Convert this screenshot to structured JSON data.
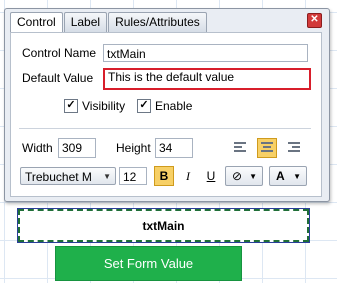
{
  "tabs": [
    "Control",
    "Label",
    "Rules/Attributes"
  ],
  "close_icon": "close-icon",
  "fields": {
    "control_name_label": "Control Name",
    "control_name_value": "txtMain",
    "default_value_label": "Default Value",
    "default_value_value": "This is the default value"
  },
  "checkboxes": {
    "visibility_label": "Visibility",
    "visibility_checked": true,
    "enable_label": "Enable",
    "enable_checked": true,
    "check_glyph": "✓"
  },
  "size": {
    "width_label": "Width",
    "width_value": "309",
    "height_label": "Height",
    "height_value": "34"
  },
  "alignment": {
    "selected": "center"
  },
  "font": {
    "family": "Trebuchet M",
    "size": "12",
    "bold_label": "B",
    "italic_label": "I",
    "underline_label": "U",
    "fill_icon": "fill-color-icon",
    "font_color_label": "A",
    "bold_active": true
  },
  "canvas": {
    "textbox_label": "txtMain",
    "button_label": "Set Form Value"
  },
  "colors": {
    "highlight_border": "#d81e2b",
    "active_toggle": "#f7d066",
    "submit_button": "#1fb04b"
  }
}
